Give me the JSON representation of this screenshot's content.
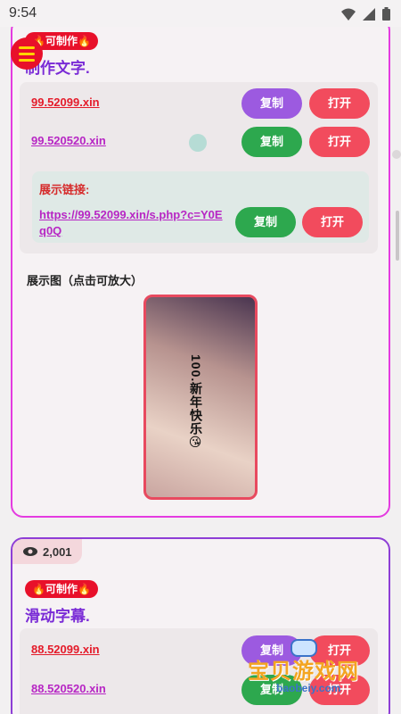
{
  "status": {
    "time": "9:54"
  },
  "card1": {
    "badge": "🔥可制作🔥",
    "title": "制作文字.",
    "links": [
      {
        "url": "99.52099.xin",
        "copy": "复制",
        "open": "打开"
      },
      {
        "url": "99.520520.xin",
        "copy": "复制",
        "open": "打开"
      }
    ],
    "display": {
      "label": "展示链接:",
      "url": "https://99.52099.xin/s.php?c=Y0Eq0Q",
      "copy": "复制",
      "open": "打开"
    },
    "image_label": "展示图（点击可放大）",
    "image_caption": "100.新年快乐😘"
  },
  "card2": {
    "views": "2,001",
    "badge": "🔥可制作🔥",
    "title": "滑动字幕.",
    "links": [
      {
        "url": "88.52099.xin",
        "copy": "复制",
        "open": "打开"
      },
      {
        "url": "88.520520.xin",
        "copy": "复制",
        "open": "打开"
      }
    ]
  },
  "watermark": {
    "text": "宝贝游戏网",
    "url": "baobeiy.com"
  },
  "colors": {
    "accent_red": "#e8102a",
    "accent_purple": "#9c5ae0",
    "accent_green": "#2da84e",
    "card1_border": "#e43be0",
    "card2_border": "#8e3ed6"
  }
}
